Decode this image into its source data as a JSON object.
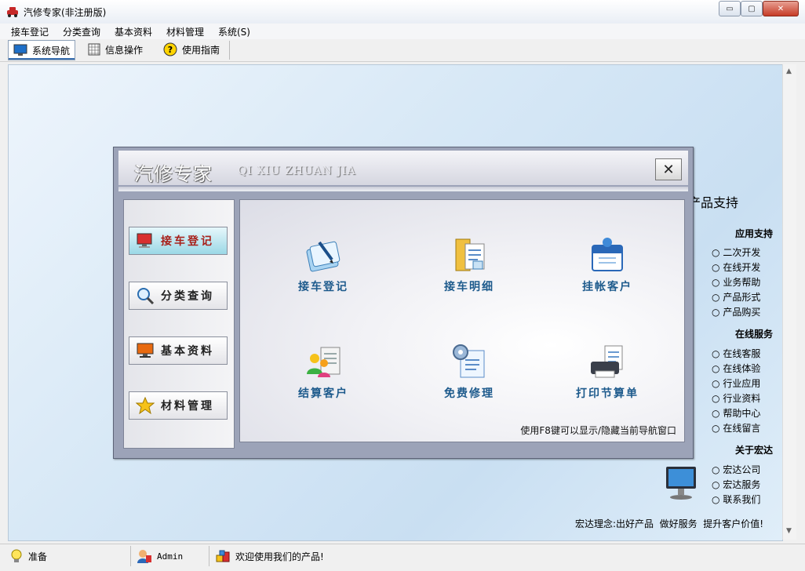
{
  "window": {
    "title": "汽修专家(非注册版)",
    "controls": {
      "minimize": "▭",
      "maximize": "▢",
      "close": "✕"
    }
  },
  "menu": [
    "接车登记",
    "分类查询",
    "基本资料",
    "材料管理",
    "系统(S)"
  ],
  "toolbar": [
    {
      "label": "系统导航",
      "icon": "monitor-icon",
      "active": true
    },
    {
      "label": "信息操作",
      "icon": "grid-icon",
      "active": false
    },
    {
      "label": "使用指南",
      "icon": "help-icon",
      "active": false
    }
  ],
  "right_panel": {
    "title": "产品支持",
    "sections": [
      {
        "heading": "应用支持",
        "links": [
          "二次开发",
          "在线开发",
          "业务帮助",
          "产品形式",
          "产品购买"
        ]
      },
      {
        "heading": "在线服务",
        "links": [
          "在线客服",
          "在线体验",
          "行业应用",
          "行业资料",
          "帮助中心",
          "在线留言"
        ]
      },
      {
        "heading": "关于宏达",
        "links": [
          "宏达公司",
          "宏达服务",
          "联系我们"
        ]
      }
    ],
    "bullet": "○",
    "slogan": "宏达理念:出好产品  做好服务  提升客户价值!"
  },
  "dialog": {
    "title": "汽修专家",
    "title_en": "QI XIU ZHUAN JIA",
    "close": "✕",
    "nav": [
      {
        "label": "接车登记",
        "icon": "computer-icon",
        "active": true
      },
      {
        "label": "分类查询",
        "icon": "magnifier-icon",
        "active": false
      },
      {
        "label": "基本资料",
        "icon": "display-icon",
        "active": false
      },
      {
        "label": "材料管理",
        "icon": "star-icon",
        "active": false
      }
    ],
    "functions": [
      {
        "label": "接车登记",
        "icon": "register-icon"
      },
      {
        "label": "接车明细",
        "icon": "folder-detail-icon"
      },
      {
        "label": "挂帐客户",
        "icon": "calendar-icon"
      },
      {
        "label": "结算客户",
        "icon": "users-icon"
      },
      {
        "label": "免费修理",
        "icon": "gear-doc-icon"
      },
      {
        "label": "打印节算单",
        "icon": "printer-icon"
      }
    ],
    "hint": "使用F8键可以显示/隐藏当前导航窗口"
  },
  "status": {
    "ready": "准备",
    "user": "Admin",
    "welcome": "欢迎使用我们的产品!"
  },
  "colors": {
    "accent": "#1d5a8c",
    "active_nav_text": "#a8201a",
    "dialog_frame": "#9ca3b8"
  }
}
